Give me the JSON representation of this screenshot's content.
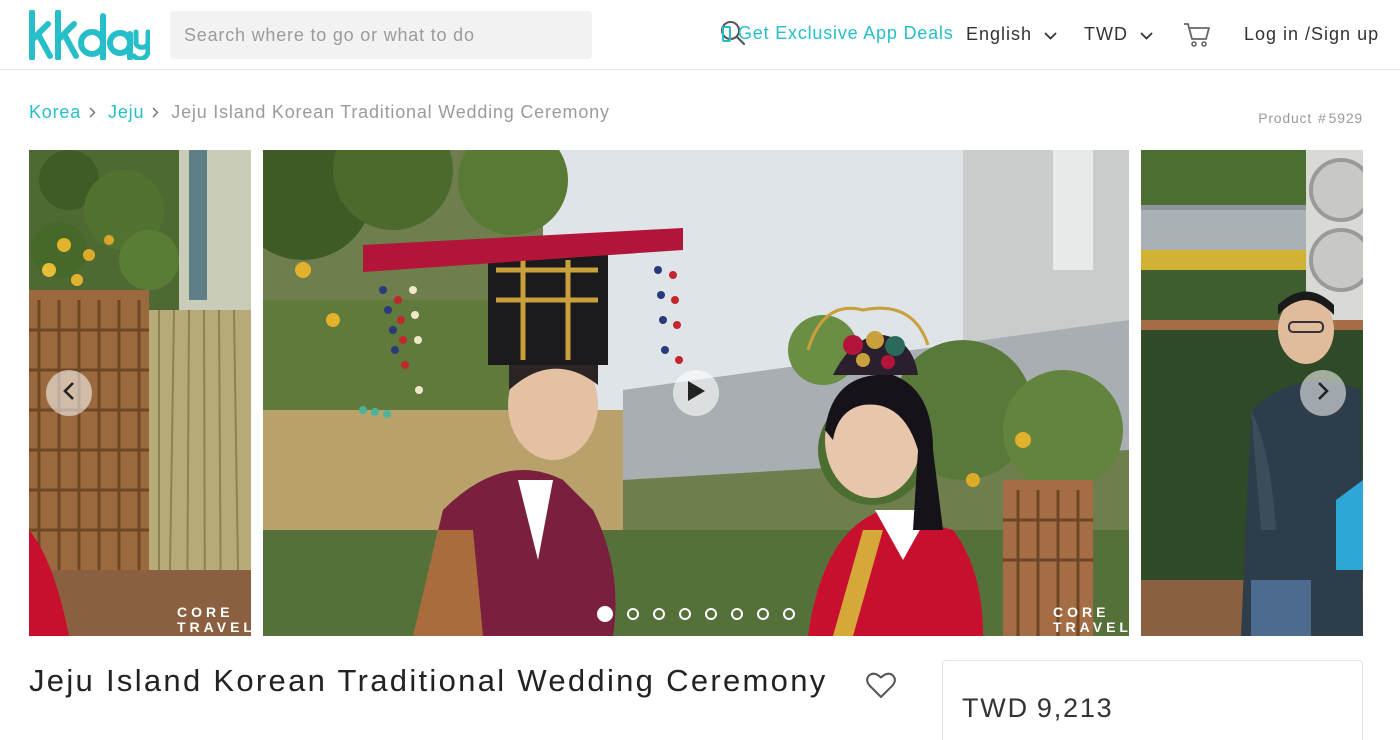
{
  "header": {
    "logo_text": "kkday",
    "search_placeholder": "Search where to go or what to do",
    "deals_label": "Get Exclusive App Deals",
    "language_label": "English",
    "currency_label": "TWD",
    "login_label": "Log in /Sign up"
  },
  "breadcrumb": {
    "items": [
      "Korea",
      "Jeju"
    ],
    "current": "Jeju Island Korean Traditional Wedding Ceremony"
  },
  "product": {
    "id_label": "Product",
    "id_hash": "#",
    "id_value": "5929",
    "title": "Jeju Island Korean Traditional Wedding Ceremony",
    "currency": "TWD",
    "price": "9,213"
  },
  "gallery": {
    "watermark_line1": "CORE",
    "watermark_line2": "TRAVEL",
    "slide_count": 8,
    "active_slide": 1
  },
  "colors": {
    "brand": "#26bec9",
    "text": "#333333",
    "muted": "#9b9b9b"
  }
}
